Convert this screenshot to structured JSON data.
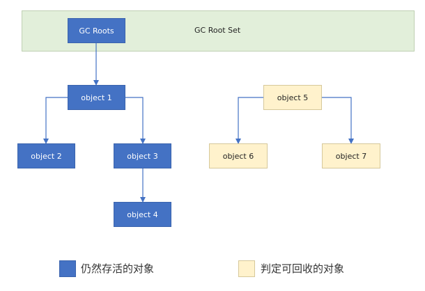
{
  "root_set": {
    "label": "GC Root Set",
    "root_node": "GC Roots"
  },
  "nodes": {
    "object1": "object 1",
    "object2": "object 2",
    "object3": "object 3",
    "object4": "object 4",
    "object5": "object 5",
    "object6": "object 6",
    "object7": "object 7"
  },
  "edges": [
    {
      "from": "GC Roots",
      "to": "object 1"
    },
    {
      "from": "object 1",
      "to": "object 2"
    },
    {
      "from": "object 1",
      "to": "object 3"
    },
    {
      "from": "object 3",
      "to": "object 4"
    },
    {
      "from": "object 5",
      "to": "object 6"
    },
    {
      "from": "object 5",
      "to": "object 7"
    }
  ],
  "legend": {
    "live_label": "仍然存活的对象",
    "dead_label": "判定可回收的对象"
  },
  "colors": {
    "live": "#4472c4",
    "dead": "#fff2cc",
    "root_set_bg": "#e2efda",
    "arrow": "#4472c4"
  }
}
